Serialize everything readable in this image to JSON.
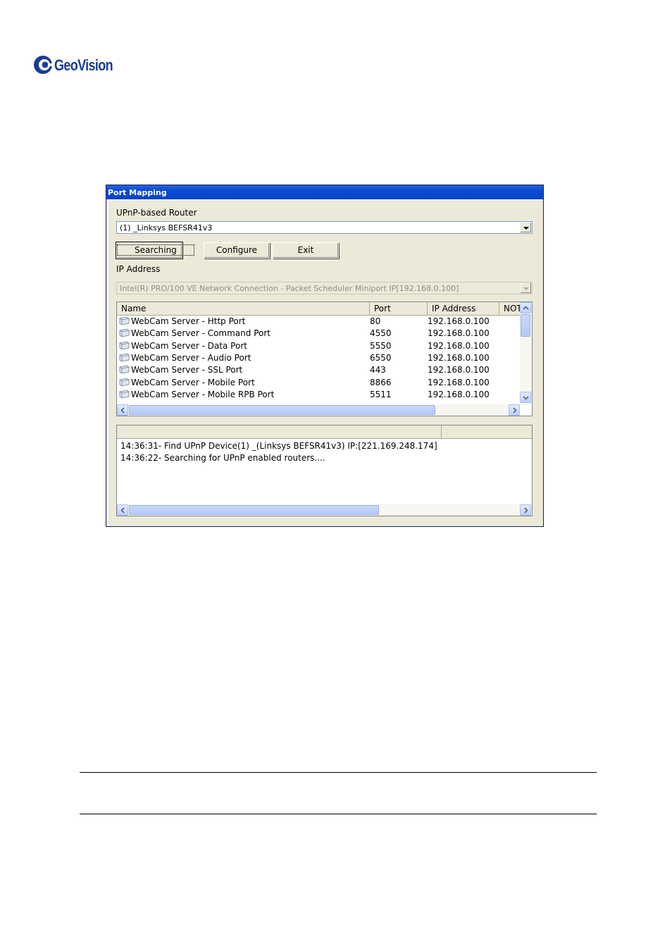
{
  "brand": {
    "name": "GeoVision",
    "color": "#1a3d8f"
  },
  "dialog": {
    "title": "Port Mapping",
    "router_label": "UPnP-based Router",
    "router_value": "(1) _Linksys BEFSR41v3",
    "buttons": {
      "searching": "Searching",
      "configure": "Configure",
      "exit": "Exit"
    },
    "ip_label": "IP Address",
    "ip_value": "Intel(R) PRO/100 VE Network Connection - Packet Scheduler Miniport  IP[192.168.0.100]",
    "ports_table": {
      "columns": [
        "Name",
        "Port",
        "IP Address",
        "NOT"
      ],
      "rows": [
        {
          "name": "WebCam Server - Http Port",
          "port": "80",
          "ip": "192.168.0.100",
          "icon": "network-port-icon"
        },
        {
          "name": "WebCam Server - Command Port",
          "port": "4550",
          "ip": "192.168.0.100",
          "icon": "network-port-icon"
        },
        {
          "name": "WebCam Server - Data Port",
          "port": "5550",
          "ip": "192.168.0.100",
          "icon": "network-port-icon"
        },
        {
          "name": "WebCam Server - Audio Port",
          "port": "6550",
          "ip": "192.168.0.100",
          "icon": "network-port-icon"
        },
        {
          "name": "WebCam Server - SSL Port",
          "port": "443",
          "ip": "192.168.0.100",
          "icon": "network-port-icon"
        },
        {
          "name": "WebCam Server - Mobile Port",
          "port": "8866",
          "ip": "192.168.0.100",
          "icon": "network-port-icon"
        },
        {
          "name": "WebCam Server - Mobile RPB Port",
          "port": "5511",
          "ip": "192.168.0.100",
          "icon": "network-port-icon"
        }
      ]
    },
    "log": {
      "lines": [
        "14:36:31- Find UPnP Device(1) _(Linksys BEFSR41v3) IP:[221.169.248.174]",
        "14:36:22- Searching for UPnP enabled routers...."
      ]
    }
  },
  "colors": {
    "titlebar": "#0a4ad0",
    "dialog_bg": "#ece9d8"
  }
}
